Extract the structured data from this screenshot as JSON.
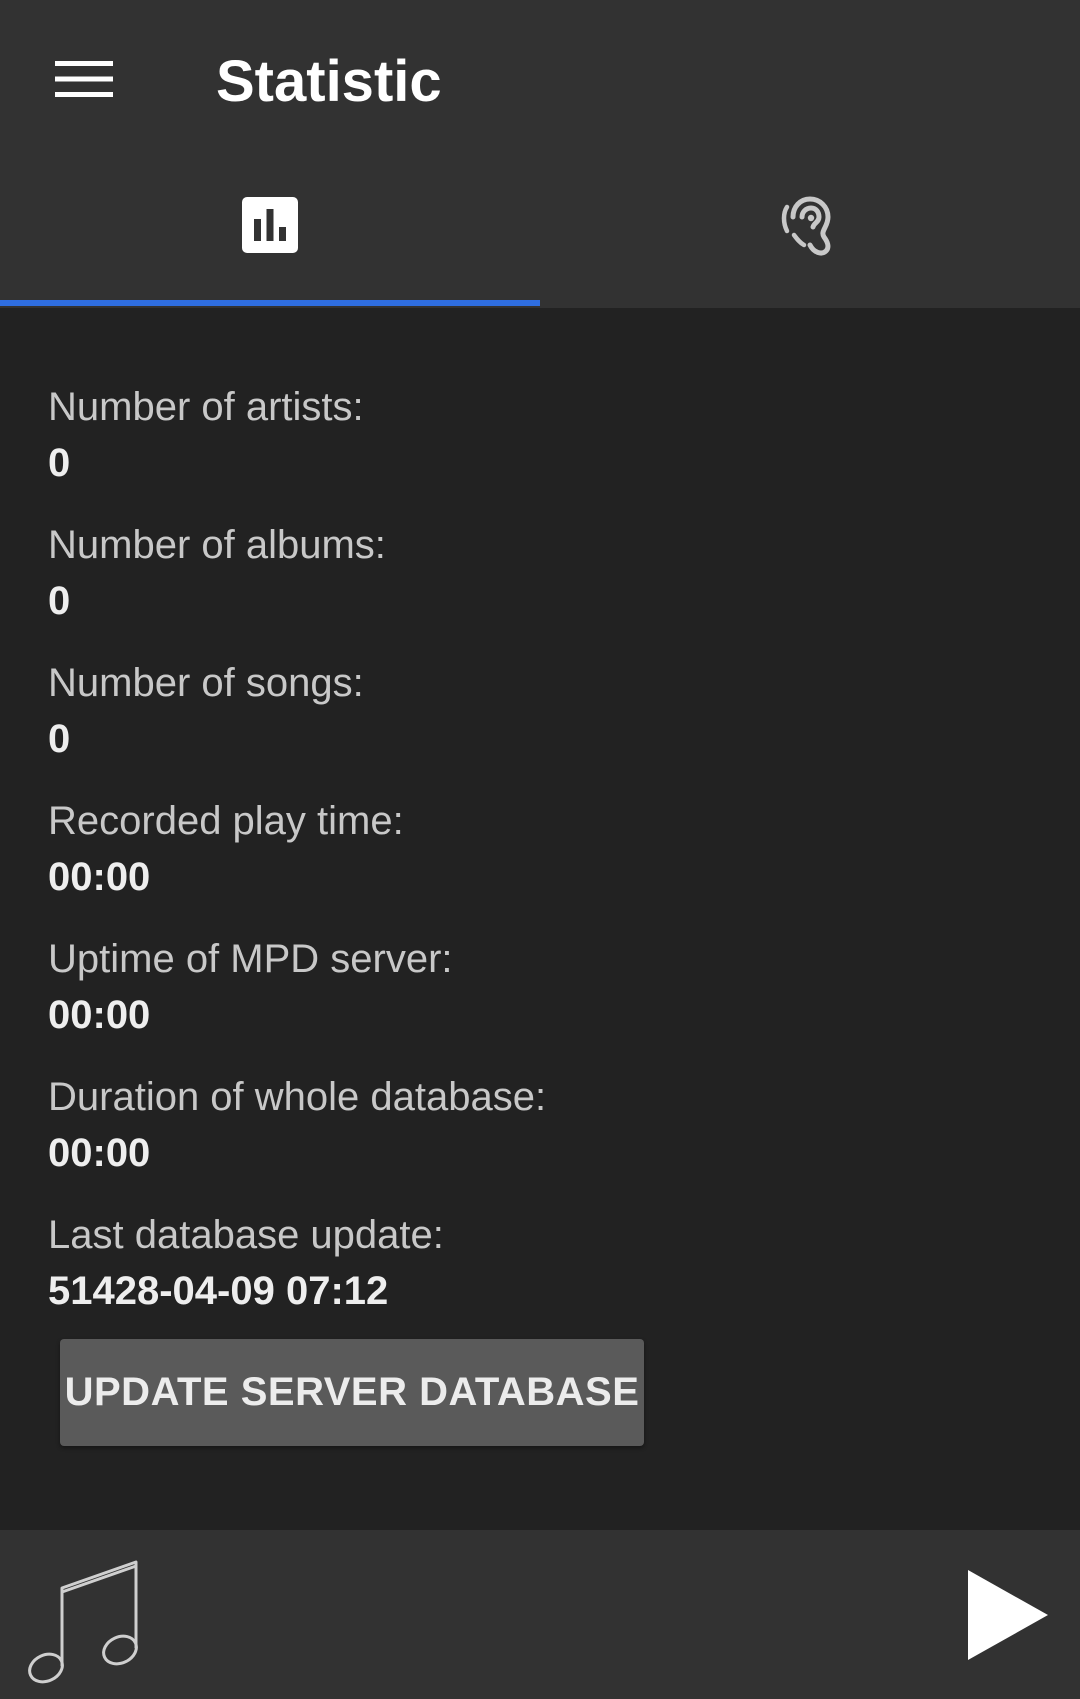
{
  "appbar": {
    "title": "Statistic",
    "menu_icon": "hamburger-menu-icon"
  },
  "tabs": [
    {
      "icon": "bar-chart-icon",
      "selected": true
    },
    {
      "icon": "ear-listening-icon",
      "selected": false
    }
  ],
  "colors": {
    "accent": "#2f6ee0",
    "background": "#222222",
    "bar": "#323232",
    "button": "#5a5a5a"
  },
  "stats": [
    {
      "label": "Number of artists:",
      "value": "0"
    },
    {
      "label": "Number of albums:",
      "value": "0"
    },
    {
      "label": "Number of songs:",
      "value": "0"
    },
    {
      "label": "Recorded play time:",
      "value": "00:00"
    },
    {
      "label": "Uptime of MPD server:",
      "value": "00:00"
    },
    {
      "label": "Duration of whole database:",
      "value": "00:00"
    },
    {
      "label": "Last database update:",
      "value": "51428-04-09 07:12"
    }
  ],
  "actions": {
    "update_label": "UPDATE SERVER DATABASE"
  },
  "player": {
    "cover_icon": "music-note-icon",
    "play_icon": "play-icon"
  }
}
